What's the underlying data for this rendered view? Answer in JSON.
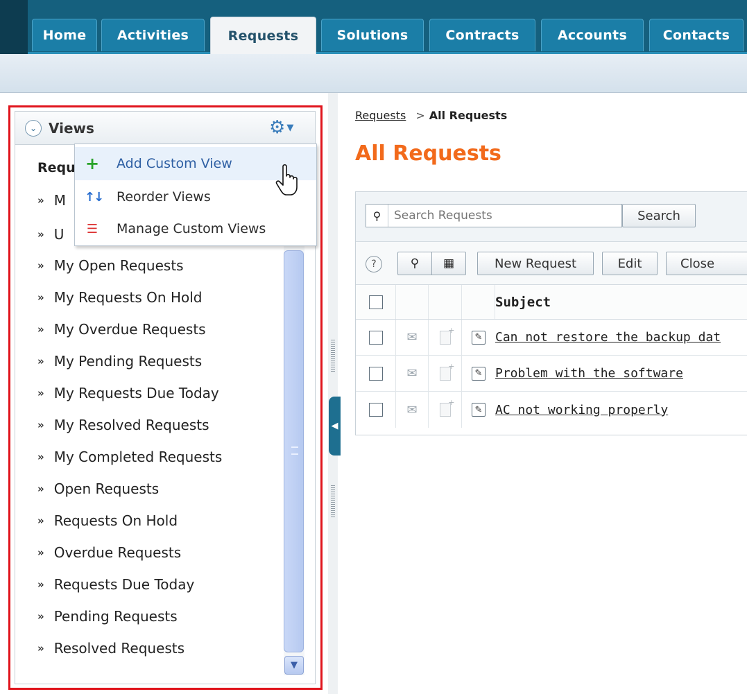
{
  "tabs": [
    "Home",
    "Activities",
    "Requests",
    "Solutions",
    "Contracts",
    "Accounts",
    "Contacts"
  ],
  "active_tab": "Requests",
  "views_panel": {
    "title": "Views",
    "list_heading": "Requ",
    "items": [
      {
        "label": "M"
      },
      {
        "label": "U"
      },
      {
        "label": "My Open Requests"
      },
      {
        "label": "My Requests On Hold"
      },
      {
        "label": "My Overdue Requests"
      },
      {
        "label": "My Pending Requests"
      },
      {
        "label": "My Requests Due Today"
      },
      {
        "label": "My Resolved Requests"
      },
      {
        "label": "My Completed Requests"
      },
      {
        "label": "Open Requests"
      },
      {
        "label": "Requests On Hold"
      },
      {
        "label": "Overdue Requests"
      },
      {
        "label": "Requests Due Today"
      },
      {
        "label": "Pending Requests"
      },
      {
        "label": "Resolved Requests"
      }
    ]
  },
  "views_menu": {
    "items": [
      {
        "label": "Add Custom View",
        "icon": "plus-icon"
      },
      {
        "label": "Reorder Views",
        "icon": "reorder-icon"
      },
      {
        "label": "Manage Custom Views",
        "icon": "list-icon"
      }
    ]
  },
  "breadcrumb": {
    "link": "Requests",
    "separator": ">",
    "current": "All Requests"
  },
  "page_title": "All Requests",
  "search": {
    "placeholder": "Search Requests",
    "button": "Search"
  },
  "toolbar": {
    "new_request": "New Request",
    "edit": "Edit",
    "close": "Close"
  },
  "table": {
    "subject_header": "Subject",
    "rows": [
      {
        "subject": "Can not restore the backup dat"
      },
      {
        "subject": "Problem with the software"
      },
      {
        "subject": "AC not working properly"
      }
    ]
  },
  "colors": {
    "accent_orange": "#f26a1b",
    "tab_blue": "#1b7ea7",
    "highlight_red": "#e0141c"
  }
}
